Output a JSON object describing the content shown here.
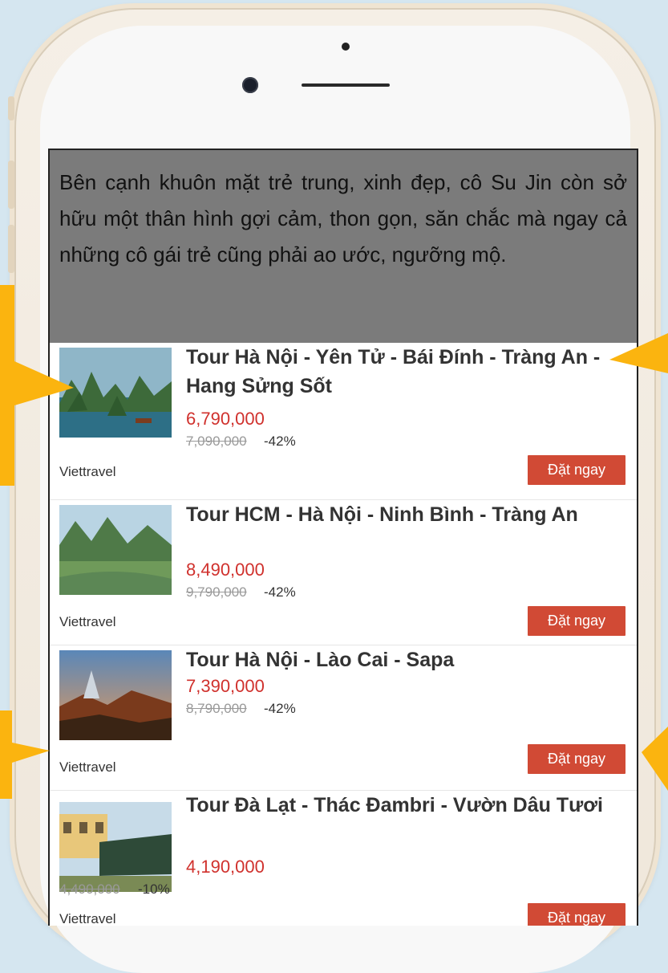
{
  "caption": "Bên cạnh khuôn mặt trẻ trung, xinh đẹp, cô Su Jin còn sở hữu một thân hình gợi cảm, thon gọn, săn chắc mà ngay cả những cô gái trẻ cũng phải ao ước, ngưỡng mộ.",
  "tours": [
    {
      "title": "Tour Hà Nội - Yên Tử - Bái Đính - Tràng An - Hang Sửng Sốt",
      "price": "6,790,000",
      "old_price": "7,090,000",
      "discount": "-42%",
      "agency": "Viettravel",
      "book_label": "Đặt ngay"
    },
    {
      "title": "Tour HCM - Hà Nội - Ninh Bình - Tràng An",
      "price": "8,490,000",
      "old_price": "9,790,000",
      "discount": "-42%",
      "agency": "Viettravel",
      "book_label": "Đặt ngay"
    },
    {
      "title": "Tour Hà Nội - Lào Cai - Sapa",
      "price": "7,390,000",
      "old_price": "8,790,000",
      "discount": "-42%",
      "agency": "Viettravel",
      "book_label": "Đặt ngay"
    },
    {
      "title": "Tour Đà Lạt - Thác Đambri - Vườn Dâu Tươi",
      "price": "4,190,000",
      "old_price": "4,490,000",
      "discount": "-10%",
      "agency": "Viettravel",
      "book_label": "Đặt ngay"
    }
  ],
  "colors": {
    "accent": "#d14a35",
    "price": "#d0312d",
    "arrow": "#fbb40f",
    "caption_bg": "#7b7b7b"
  }
}
